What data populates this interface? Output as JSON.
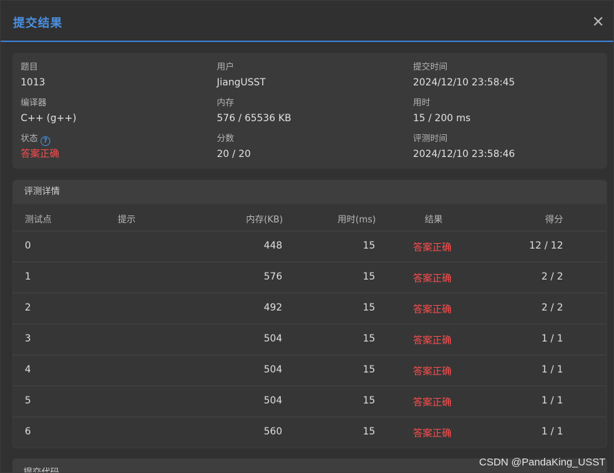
{
  "modal": {
    "title": "提交结果"
  },
  "info": {
    "problem_label": "题目",
    "problem_value": "1013",
    "user_label": "用户",
    "user_value": "JiangUSST",
    "submit_time_label": "提交时间",
    "submit_time_value": "2024/12/10 23:58:45",
    "compiler_label": "编译器",
    "compiler_value": "C++ (g++)",
    "memory_label": "内存",
    "memory_value": "576 / 65536 KB",
    "time_label": "用时",
    "time_value": "15 / 200 ms",
    "status_label": "状态",
    "status_help": "?",
    "status_value": "答案正确",
    "score_label": "分数",
    "score_value": "20 / 20",
    "judge_time_label": "评测时间",
    "judge_time_value": "2024/12/10 23:58:46"
  },
  "detail": {
    "title": "评测详情",
    "headers": [
      "测试点",
      "提示",
      "内存(KB)",
      "用时(ms)",
      "结果",
      "得分"
    ],
    "rows": [
      {
        "case": "0",
        "hint": "",
        "memory": "448",
        "time": "15",
        "result": "答案正确",
        "score": "12 / 12"
      },
      {
        "case": "1",
        "hint": "",
        "memory": "576",
        "time": "15",
        "result": "答案正确",
        "score": "2 / 2"
      },
      {
        "case": "2",
        "hint": "",
        "memory": "492",
        "time": "15",
        "result": "答案正确",
        "score": "2 / 2"
      },
      {
        "case": "3",
        "hint": "",
        "memory": "504",
        "time": "15",
        "result": "答案正确",
        "score": "1 / 1"
      },
      {
        "case": "4",
        "hint": "",
        "memory": "504",
        "time": "15",
        "result": "答案正确",
        "score": "1 / 1"
      },
      {
        "case": "5",
        "hint": "",
        "memory": "504",
        "time": "15",
        "result": "答案正确",
        "score": "1 / 1"
      },
      {
        "case": "6",
        "hint": "",
        "memory": "560",
        "time": "15",
        "result": "答案正确",
        "score": "1 / 1"
      }
    ]
  },
  "code": {
    "title": "提交代码"
  },
  "watermark": "CSDN @PandaKing_USST",
  "colors": {
    "accent": "#4a90e2",
    "success_text": "#ff4d4d"
  }
}
